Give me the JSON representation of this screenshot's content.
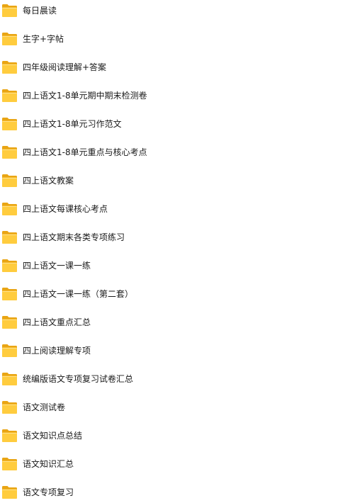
{
  "folders": [
    {
      "label": "每日晨读",
      "icon": "folder-icon"
    },
    {
      "label": "生字+字帖",
      "icon": "folder-icon"
    },
    {
      "label": "四年级阅读理解+答案",
      "icon": "folder-icon"
    },
    {
      "label": "四上语文1-8单元期中期末检测卷",
      "icon": "folder-icon"
    },
    {
      "label": "四上语文1-8单元习作范文",
      "icon": "folder-icon"
    },
    {
      "label": "四上语文1-8单元重点与核心考点",
      "icon": "folder-icon"
    },
    {
      "label": "四上语文教案",
      "icon": "folder-icon"
    },
    {
      "label": "四上语文每课核心考点",
      "icon": "folder-icon"
    },
    {
      "label": "四上语文期末各类专项练习",
      "icon": "folder-icon"
    },
    {
      "label": "四上语文一课一练",
      "icon": "folder-icon"
    },
    {
      "label": "四上语文一课一练（第二套）",
      "icon": "folder-icon"
    },
    {
      "label": "四上语文重点汇总",
      "icon": "folder-icon"
    },
    {
      "label": "四上阅读理解专项",
      "icon": "folder-icon"
    },
    {
      "label": "统编版语文专项复习试卷汇总",
      "icon": "folder-icon"
    },
    {
      "label": "语文测试卷",
      "icon": "folder-icon"
    },
    {
      "label": "语文知识点总结",
      "icon": "folder-icon"
    },
    {
      "label": "语文知识汇总",
      "icon": "folder-icon"
    },
    {
      "label": "语文专项复习",
      "icon": "folder-icon"
    }
  ],
  "colors": {
    "folder_back": "#F5B21C",
    "folder_front": "#FFCC3E",
    "folder_tab": "#E9A514",
    "label_text": "#1a1a1a",
    "background": "#ffffff"
  }
}
